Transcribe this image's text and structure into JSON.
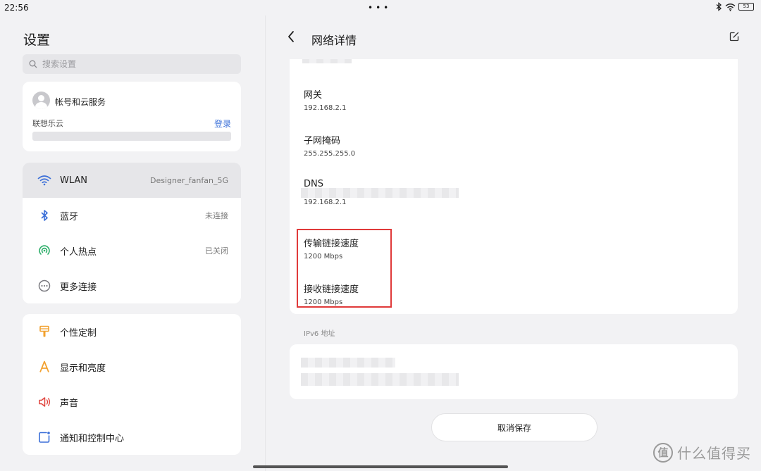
{
  "status_bar": {
    "time": "22:56",
    "dots": "•••",
    "battery": "53"
  },
  "settings": {
    "title": "设置",
    "search_placeholder": "搜索设置",
    "account": {
      "title": "帐号和云服务",
      "cloud_label": "联想乐云",
      "login_label": "登录"
    },
    "network_items": [
      {
        "label": "WLAN",
        "value": "Designer_fanfan_5G",
        "icon": "wifi-icon",
        "color": "#3b6fd8"
      },
      {
        "label": "蓝牙",
        "value": "未连接",
        "icon": "bluetooth-icon",
        "color": "#3b6fd8"
      },
      {
        "label": "个人热点",
        "value": "已关闭",
        "icon": "hotspot-icon",
        "color": "#2eae6a"
      },
      {
        "label": "更多连接",
        "value": "",
        "icon": "more-connections-icon",
        "color": "#7a7a80"
      }
    ],
    "personal_items": [
      {
        "label": "个性定制",
        "icon": "brush-icon",
        "color": "#f2a12f"
      },
      {
        "label": "显示和亮度",
        "icon": "display-icon",
        "color": "#f2a12f"
      },
      {
        "label": "声音",
        "icon": "speaker-icon",
        "color": "#e0443e"
      },
      {
        "label": "通知和控制中心",
        "icon": "notification-icon",
        "color": "#3b6fd8"
      }
    ]
  },
  "detail": {
    "title": "网络详情",
    "items": [
      {
        "label": "网关",
        "value": "192.168.2.1"
      },
      {
        "label": "子网掩码",
        "value": "255.255.255.0"
      },
      {
        "label": "DNS",
        "value": "192.168.2.1"
      },
      {
        "label": "传输链接速度",
        "value": "1200 Mbps"
      },
      {
        "label": "接收链接速度",
        "value": "1200 Mbps"
      }
    ],
    "ipv6_label": "IPv6 地址",
    "cancel_save": "取消保存"
  },
  "watermark": {
    "badge": "值",
    "text": "什么值得买"
  },
  "colors": {
    "accent": "#3a6fd8",
    "highlight": "#e03a3a"
  }
}
